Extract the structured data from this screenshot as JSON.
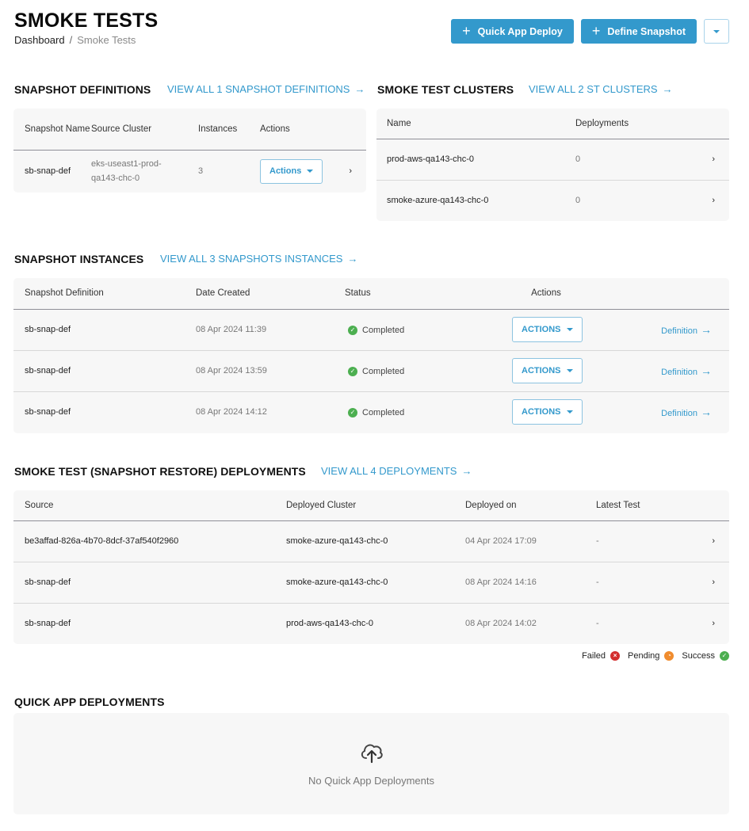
{
  "header": {
    "title": "SMOKE TESTS",
    "breadcrumb": [
      {
        "label": "Dashboard"
      },
      {
        "label": "Smoke Tests"
      }
    ],
    "breadcrumb_sep": "/",
    "buttons": {
      "quick_app_deploy": "Quick App Deploy",
      "define_snapshot": "Define Snapshot",
      "plus_icon": "+"
    }
  },
  "snapshot_definitions": {
    "title": "SNAPSHOT DEFINITIONS",
    "view_all": "VIEW ALL 1 SNAPSHOT DEFINITIONS",
    "columns": [
      "Snapshot Name",
      "Source Cluster",
      "Instances",
      "Actions"
    ],
    "rows": [
      {
        "name": "sb-snap-def",
        "source_cluster": "eks-useast1-prod-qa143-chc-0",
        "instances": "3",
        "actions_label": "Actions"
      }
    ]
  },
  "smoke_test_clusters": {
    "title": "SMOKE TEST CLUSTERS",
    "view_all": "VIEW ALL 2 ST CLUSTERS",
    "columns": [
      "Name",
      "Deployments"
    ],
    "rows": [
      {
        "name": "prod-aws-qa143-chc-0",
        "deployments": "0"
      },
      {
        "name": "smoke-azure-qa143-chc-0",
        "deployments": "0"
      }
    ]
  },
  "snapshot_instances": {
    "title": "SNAPSHOT INSTANCES",
    "view_all": "VIEW ALL 3 SNAPSHOTS INSTANCES",
    "columns": [
      "Snapshot Definition",
      "Date Created",
      "Status",
      "Actions"
    ],
    "rows": [
      {
        "definition": "sb-snap-def",
        "date_created": "08 Apr 2024 11:39",
        "status": "Completed",
        "actions_label": "ACTIONS",
        "link": "Definition"
      },
      {
        "definition": "sb-snap-def",
        "date_created": "08 Apr 2024 13:59",
        "status": "Completed",
        "actions_label": "ACTIONS",
        "link": "Definition"
      },
      {
        "definition": "sb-snap-def",
        "date_created": "08 Apr 2024 14:12",
        "status": "Completed",
        "actions_label": "ACTIONS",
        "link": "Definition"
      }
    ]
  },
  "deployments": {
    "title": "SMOKE TEST (SNAPSHOT RESTORE) DEPLOYMENTS",
    "view_all": "VIEW ALL 4 DEPLOYMENTS",
    "columns": [
      "Source",
      "Deployed Cluster",
      "Deployed on",
      "Latest Test"
    ],
    "rows": [
      {
        "source": "be3affad-826a-4b70-8dcf-37af540f2960",
        "cluster": "smoke-azure-qa143-chc-0",
        "deployed_on": "04 Apr 2024 17:09",
        "latest_test": "-"
      },
      {
        "source": "sb-snap-def",
        "cluster": "smoke-azure-qa143-chc-0",
        "deployed_on": "08 Apr 2024 14:16",
        "latest_test": "-"
      },
      {
        "source": "sb-snap-def",
        "cluster": "prod-aws-qa143-chc-0",
        "deployed_on": "08 Apr 2024 14:02",
        "latest_test": "-"
      }
    ],
    "legend": [
      {
        "label": "Failed",
        "color": "#d32f2f",
        "glyph": "×"
      },
      {
        "label": "Pending",
        "color": "#f08c2e",
        "glyph": "◔"
      },
      {
        "label": "Success",
        "color": "#4caf50",
        "glyph": "✓"
      }
    ]
  },
  "quick_app_deployments": {
    "title": "QUICK APP DEPLOYMENTS",
    "empty_text": "No Quick App Deployments"
  },
  "icons": {
    "arrow_right": "→",
    "chevron_right": "›",
    "check": "✓"
  },
  "colors": {
    "accent": "#3399cc",
    "success": "#4caf50",
    "failed": "#d32f2f",
    "pending": "#f08c2e",
    "card_bg": "#f7f7f7"
  }
}
